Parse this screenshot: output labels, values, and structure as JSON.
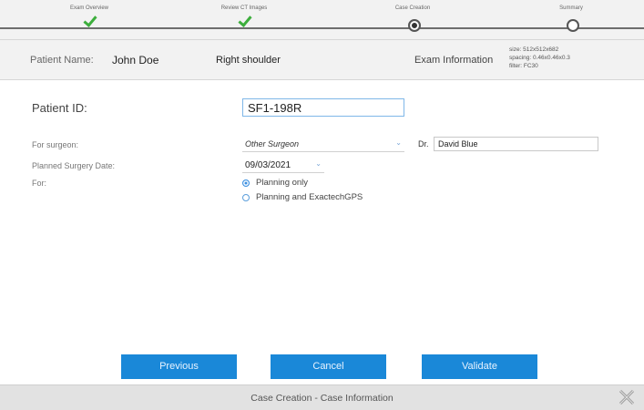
{
  "stepper": {
    "steps": [
      {
        "label": "Exam Overview",
        "state": "done"
      },
      {
        "label": "Review CT Images",
        "state": "done"
      },
      {
        "label": "Case Creation",
        "state": "current"
      },
      {
        "label": "Summary",
        "state": "pending"
      }
    ]
  },
  "patient_info": {
    "name_label": "Patient Name:",
    "name_value": "John Doe",
    "side": "Right shoulder",
    "exam_label": "Exam Information",
    "exam_size": "size: 512x512x682",
    "exam_spacing": "spacing: 0.46x0.46x0.3",
    "exam_filter": "filter: FC30"
  },
  "form": {
    "patient_id_label": "Patient ID:",
    "patient_id_value": "SF1-198R",
    "surgeon_label": "For surgeon:",
    "surgeon_value": "Other Surgeon",
    "dr_label": "Dr.",
    "dr_value": "David Blue",
    "date_label": "Planned Surgery Date:",
    "date_value": "09/03/2021",
    "for_label": "For:",
    "options": [
      {
        "label": "Planning only",
        "checked": true
      },
      {
        "label": "Planning and ExactechGPS",
        "checked": false
      }
    ]
  },
  "buttons": {
    "previous": "Previous",
    "cancel": "Cancel",
    "validate": "Validate"
  },
  "footer": {
    "title": "Case Creation - Case Information"
  },
  "colors": {
    "accent": "#1a88d8",
    "check": "#3cae3c"
  }
}
